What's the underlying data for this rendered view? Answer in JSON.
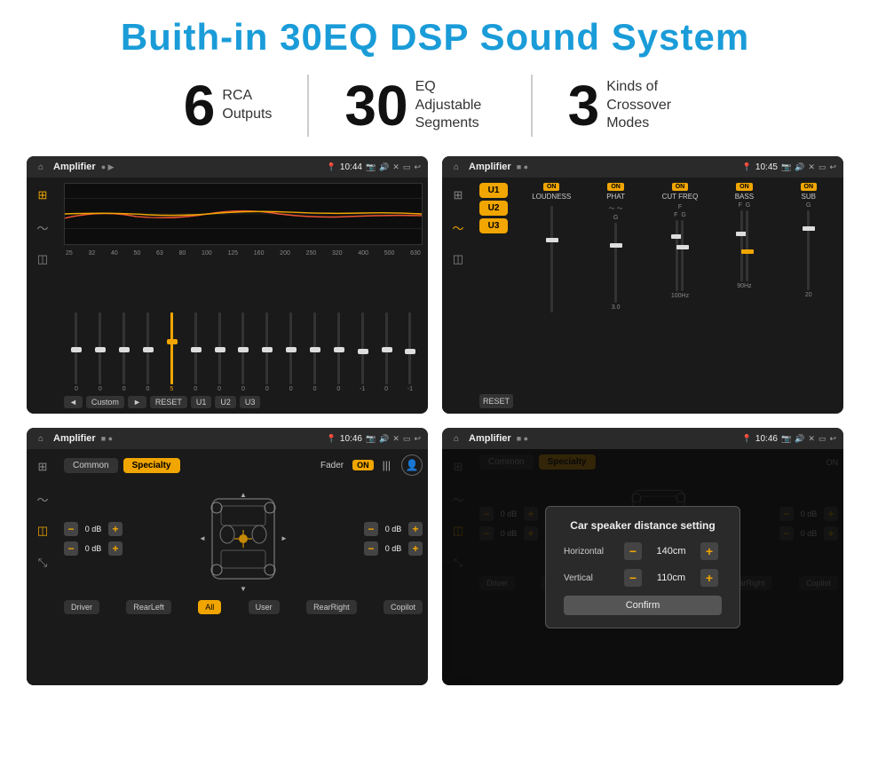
{
  "title": "Buith-in 30EQ DSP Sound System",
  "stats": [
    {
      "number": "6",
      "label": "RCA\nOutputs"
    },
    {
      "number": "30",
      "label": "EQ Adjustable\nSegments"
    },
    {
      "number": "3",
      "label": "Kinds of\nCrossover Modes"
    }
  ],
  "screens": [
    {
      "id": "eq-screen",
      "topbar": {
        "title": "Amplifier",
        "time": "10:44"
      },
      "type": "eq"
    },
    {
      "id": "crossover-screen",
      "topbar": {
        "title": "Amplifier",
        "time": "10:45"
      },
      "type": "crossover"
    },
    {
      "id": "fader-screen",
      "topbar": {
        "title": "Amplifier",
        "time": "10:46"
      },
      "type": "fader"
    },
    {
      "id": "distance-screen",
      "topbar": {
        "title": "Amplifier",
        "time": "10:46"
      },
      "type": "distance"
    }
  ],
  "eq": {
    "frequencies": [
      "25",
      "32",
      "40",
      "50",
      "63",
      "80",
      "100",
      "125",
      "160",
      "200",
      "250",
      "320",
      "400",
      "500",
      "630"
    ],
    "values": [
      "0",
      "0",
      "0",
      "0",
      "5",
      "0",
      "0",
      "0",
      "0",
      "0",
      "0",
      "0",
      "-1",
      "0",
      "-1"
    ],
    "presets": [
      "◄",
      "Custom",
      "►"
    ],
    "buttons": [
      "RESET",
      "U1",
      "U2",
      "U3"
    ]
  },
  "crossover": {
    "presets": [
      "U1",
      "U2",
      "U3"
    ],
    "channels": [
      "LOUDNESS",
      "PHAT",
      "CUT FREQ",
      "BASS",
      "SUB"
    ],
    "on_labels": [
      "ON",
      "ON",
      "ON",
      "ON",
      "ON"
    ],
    "reset_label": "RESET"
  },
  "fader": {
    "tabs": [
      "Common",
      "Specialty"
    ],
    "active_tab": "Specialty",
    "fader_label": "Fader",
    "on_label": "ON",
    "db_values": [
      "0 dB",
      "0 dB",
      "0 dB",
      "0 dB"
    ],
    "bottom_btns": [
      "Driver",
      "RearLeft",
      "All",
      "User",
      "RearRight",
      "Copilot"
    ]
  },
  "distance_dialog": {
    "title": "Car speaker distance setting",
    "horizontal_label": "Horizontal",
    "horizontal_value": "140cm",
    "vertical_label": "Vertical",
    "vertical_value": "110cm",
    "confirm_label": "Confirm"
  }
}
